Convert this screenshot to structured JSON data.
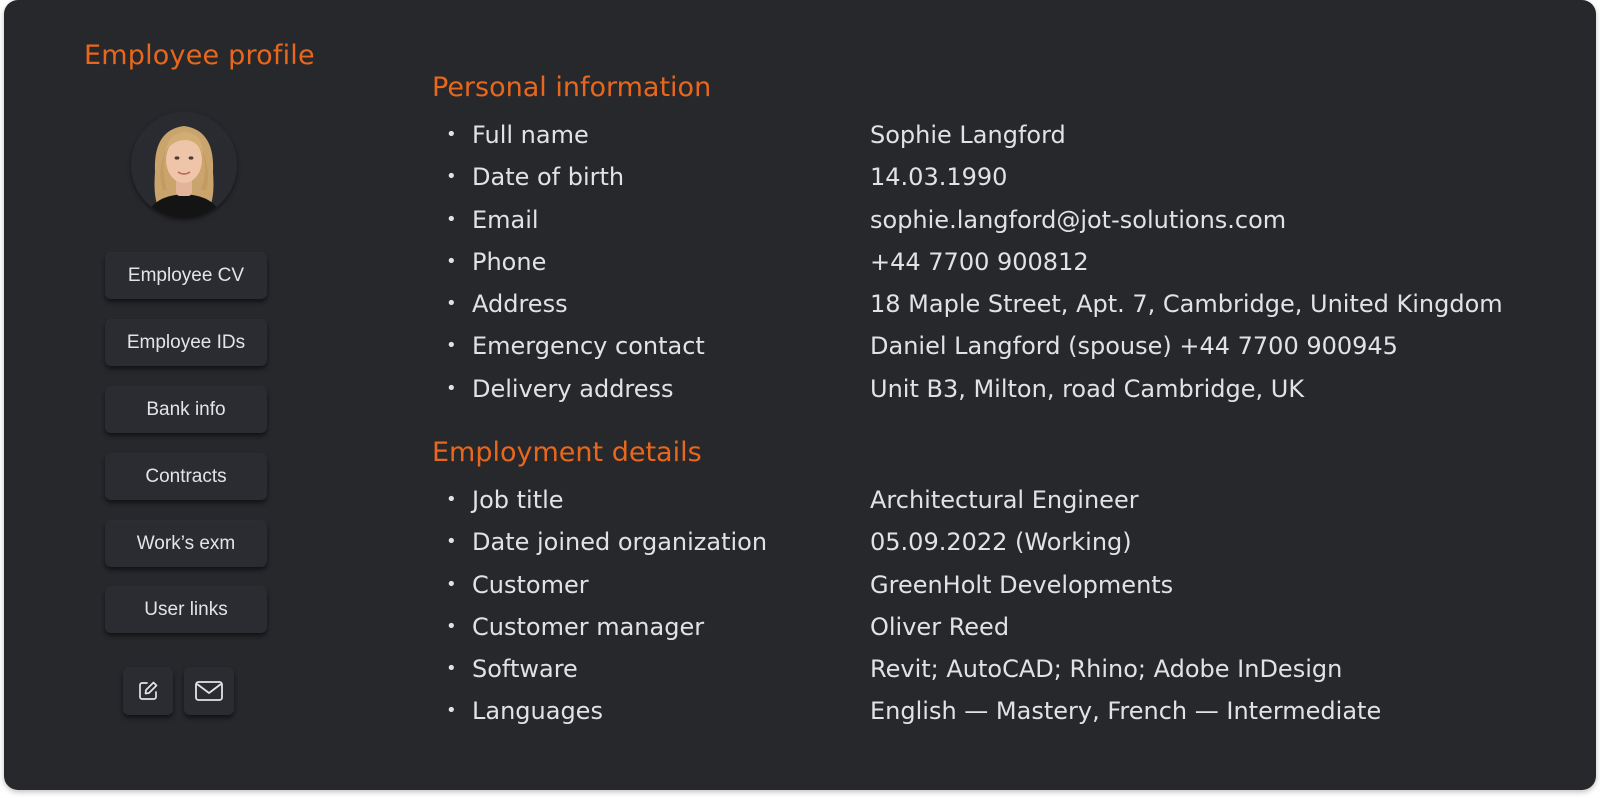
{
  "profile": {
    "title": "Employee profile",
    "buttons": [
      "Employee CV",
      "Employee IDs",
      "Bank info",
      "Contracts",
      "Work’s exm",
      "User links"
    ],
    "icons": [
      "edit-icon",
      "mail-icon"
    ]
  },
  "personal": {
    "title": "Personal information",
    "rows": [
      {
        "label": "Full name",
        "value": "Sophie Langford"
      },
      {
        "label": "Date of birth",
        "value": "14.03.1990"
      },
      {
        "label": "Email",
        "value": "sophie.langford@jot-solutions.com"
      },
      {
        "label": "Phone",
        "value": "+44 7700 900812"
      },
      {
        "label": "Address",
        "value": "18 Maple Street, Apt. 7,  Cambridge,  United Kingdom"
      },
      {
        "label": "Emergency contact",
        "value": "Daniel Langford (spouse)  +44 7700 900945"
      },
      {
        "label": "Delivery address",
        "value": "Unit B3, Milton, road Cambridge, UK"
      }
    ]
  },
  "employment": {
    "title": "Employment details",
    "rows": [
      {
        "label": "Job title",
        "value": "Architectural Engineer"
      },
      {
        "label": "Date joined organization",
        "value": "05.09.2022 (Working)"
      },
      {
        "label": "Customer",
        "value": "GreenHolt Developments"
      },
      {
        "label": "Customer manager",
        "value": "Oliver Reed"
      },
      {
        "label": "Software",
        "value": "Revit; AutoCAD; Rhino; Adobe InDesign"
      },
      {
        "label": "Languages",
        "value": "English — Mastery,  French — Intermediate"
      }
    ]
  },
  "colors": {
    "accent": "#e8671c",
    "background": "#27282c",
    "text": "#e2e2e4"
  }
}
